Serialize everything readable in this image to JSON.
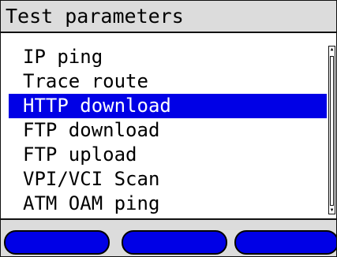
{
  "header": {
    "title": "Test parameters"
  },
  "menu": {
    "selected_index": 2,
    "items": [
      {
        "label": "IP ping"
      },
      {
        "label": "Trace route"
      },
      {
        "label": "HTTP download"
      },
      {
        "label": "FTP download"
      },
      {
        "label": "FTP upload"
      },
      {
        "label": "VPI/VCI Scan"
      },
      {
        "label": "ATM OAM ping"
      }
    ]
  },
  "softkeys": [
    {
      "label": ""
    },
    {
      "label": ""
    },
    {
      "label": ""
    }
  ],
  "colors": {
    "highlight": "#0000e6",
    "bar_background": "#dcdcdc"
  },
  "icons": {
    "scroll_up": "triangle-up-icon",
    "scroll_down": "triangle-down-icon"
  }
}
